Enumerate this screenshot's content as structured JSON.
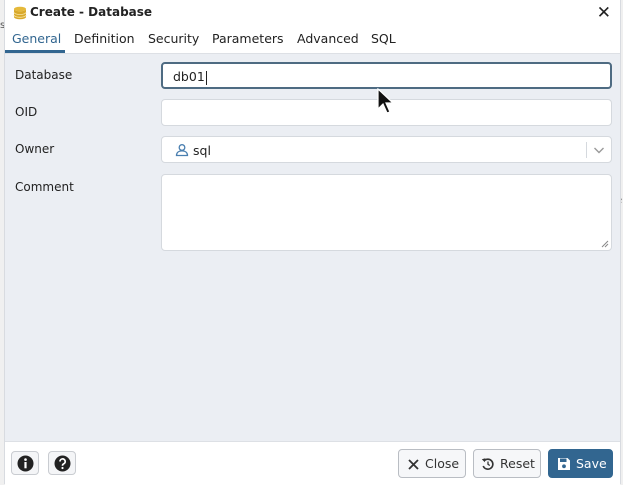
{
  "window": {
    "title": "Create - Database",
    "close_symbol": "✕"
  },
  "tabs": [
    {
      "label": "General",
      "active": true
    },
    {
      "label": "Definition",
      "active": false
    },
    {
      "label": "Security",
      "active": false
    },
    {
      "label": "Parameters",
      "active": false
    },
    {
      "label": "Advanced",
      "active": false
    },
    {
      "label": "SQL",
      "active": false
    }
  ],
  "form": {
    "database": {
      "label": "Database",
      "value": "db01"
    },
    "oid": {
      "label": "OID",
      "value": ""
    },
    "owner": {
      "label": "Owner",
      "value": "sql"
    },
    "comment": {
      "label": "Comment",
      "value": ""
    }
  },
  "footer": {
    "close_label": "Close",
    "reset_label": "Reset",
    "save_label": "Save"
  },
  "colors": {
    "accent": "#326690",
    "panel_bg": "#ebeef3",
    "db_icon": "#e5b93a"
  },
  "icons": [
    "database-icon",
    "close-icon",
    "user-icon",
    "chevron-down-icon",
    "info-icon",
    "help-icon",
    "x-icon",
    "reset-icon",
    "save-icon"
  ]
}
